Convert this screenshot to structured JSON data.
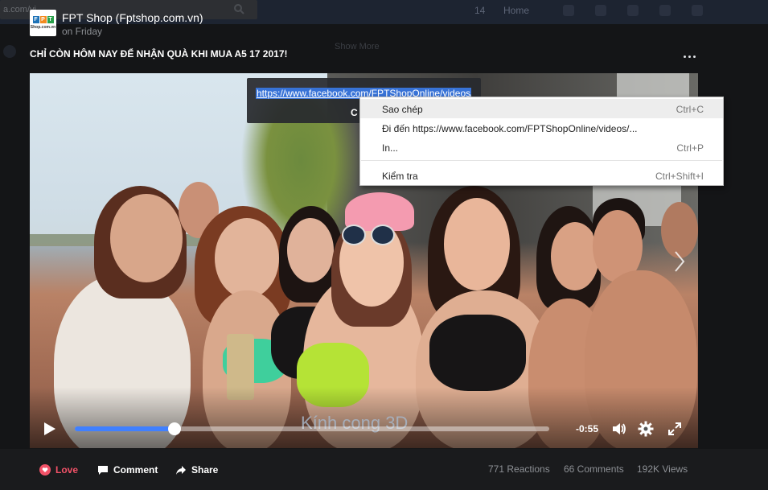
{
  "background": {
    "search_text": "a.com/vi...",
    "nav_count": "14",
    "nav_home": "Home",
    "show_more": "Show More"
  },
  "post": {
    "page_name": "FPT Shop (Fptshop.com.vn)",
    "time": "on Friday",
    "title": "CHỈ CÒN HÔM NAY ĐỂ NHẬN QUÀ KHI MUA A5 17 2017!",
    "logo_letters": [
      "F",
      "P",
      "T"
    ],
    "logo_sub": "Shop.com.vn"
  },
  "video": {
    "caption": "Kính cong 3D",
    "time_remaining": "-0:55",
    "progress": 0.21,
    "url": "https://www.facebook.com/FPTShopOnline/videos/",
    "copy_label": "C"
  },
  "context_menu": {
    "items": [
      {
        "label": "Sao chép",
        "shortcut": "Ctrl+C"
      },
      {
        "label": "Đi đến https://www.facebook.com/FPTShopOnline/videos/...",
        "shortcut": ""
      },
      {
        "label": "In...",
        "shortcut": "Ctrl+P"
      },
      {
        "label": "Kiểm tra",
        "shortcut": "Ctrl+Shift+I"
      }
    ]
  },
  "actions": {
    "love": "Love",
    "comment": "Comment",
    "share": "Share"
  },
  "stats": {
    "reactions": "771 Reactions",
    "comments": "66 Comments",
    "views": "192K Views"
  },
  "colors": {
    "accent": "#4080ff",
    "love": "#f25268",
    "selection": "#3873d7"
  }
}
